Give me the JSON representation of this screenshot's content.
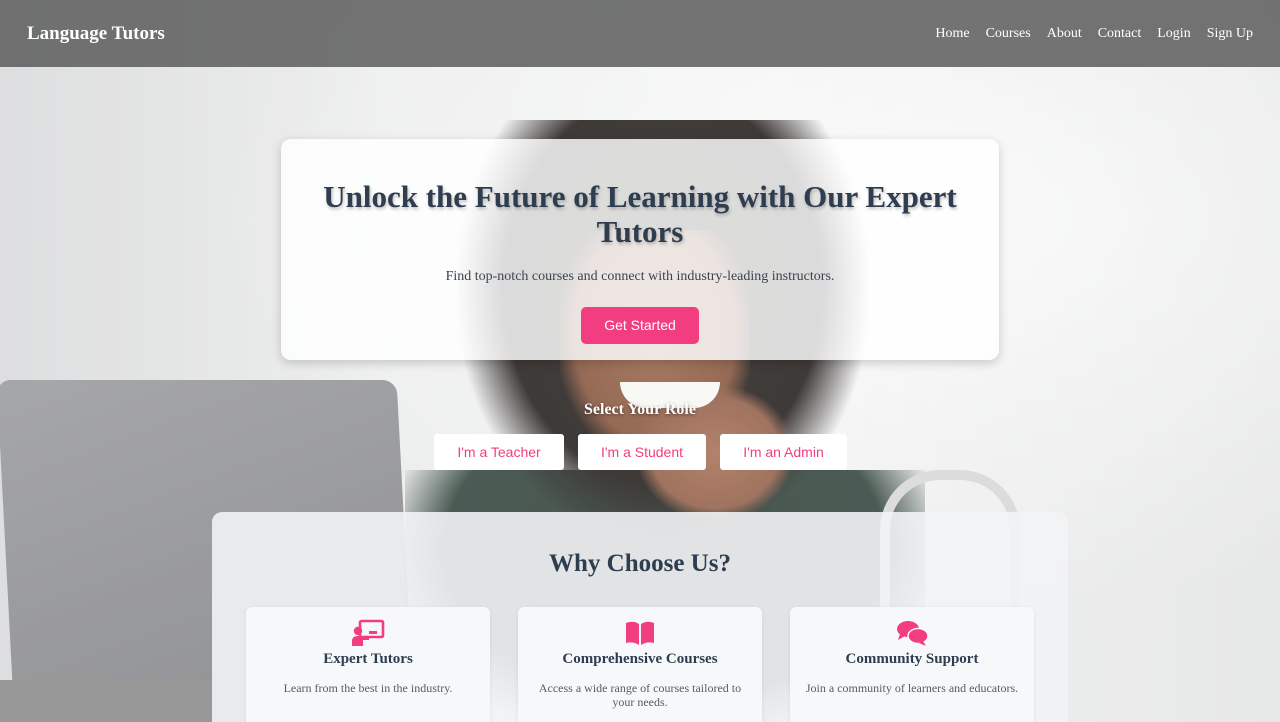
{
  "nav": {
    "brand": "Language Tutors",
    "links": [
      "Home",
      "Courses",
      "About",
      "Contact",
      "Login",
      "Sign Up"
    ]
  },
  "hero": {
    "title": "Unlock the Future of Learning with Our Expert Tutors",
    "subtitle": "Find top-notch courses and connect with industry-leading instructors.",
    "cta_label": "Get Started"
  },
  "roles": {
    "title": "Select Your Role",
    "buttons": [
      "I'm a Teacher",
      "I'm a Student",
      "I'm an Admin"
    ]
  },
  "why": {
    "title": "Why Choose Us?",
    "features": [
      {
        "icon": "chalkboard-teacher-icon",
        "title": "Expert Tutors",
        "desc": "Learn from the best in the industry."
      },
      {
        "icon": "book-open-icon",
        "title": "Comprehensive Courses",
        "desc": "Access a wide range of courses tailored to your needs."
      },
      {
        "icon": "comments-icon",
        "title": "Community Support",
        "desc": "Join a community of learners and educators."
      }
    ]
  },
  "colors": {
    "accent": "#f23d80",
    "heading": "#2e3d4f",
    "navbar": "#5c5c5c"
  }
}
